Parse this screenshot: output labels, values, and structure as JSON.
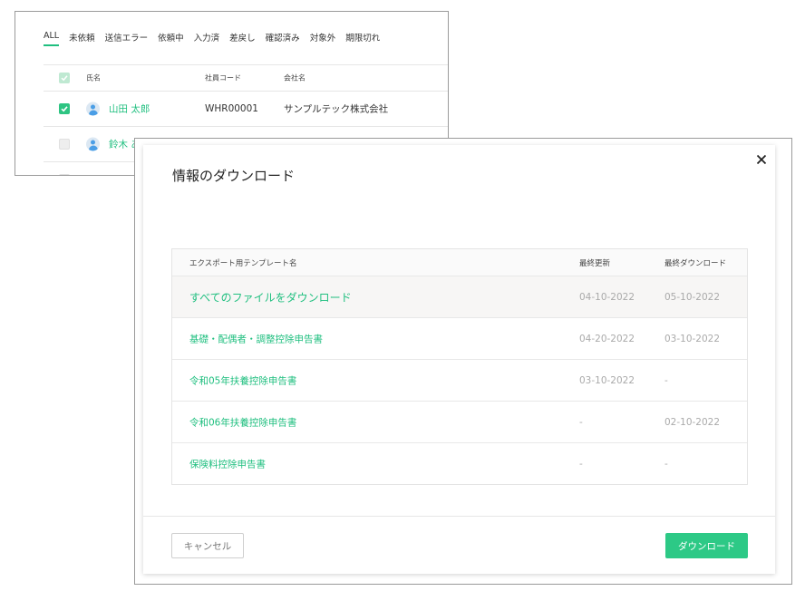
{
  "background_list": {
    "tabs": [
      {
        "label": "ALL",
        "active": true
      },
      {
        "label": "未依頼"
      },
      {
        "label": "送信エラー"
      },
      {
        "label": "依頼中"
      },
      {
        "label": "入力済"
      },
      {
        "label": "差戻し"
      },
      {
        "label": "確認済み"
      },
      {
        "label": "対象外"
      },
      {
        "label": "期限切れ"
      }
    ],
    "columns": {
      "name": "氏名",
      "code": "社員コード",
      "company": "会社名"
    },
    "rows": [
      {
        "name": "山田 太郎",
        "code": "WHR00001",
        "company": "サンプルテック株式会社",
        "checked": true
      },
      {
        "name": "鈴木 あ",
        "code": "",
        "company": "",
        "checked": false
      }
    ]
  },
  "modal": {
    "title": "情報のダウンロード",
    "table": {
      "headers": {
        "template_name": "エクスポート用テンプレート名",
        "last_updated": "最終更新",
        "last_download": "最終ダウンロード"
      },
      "rows": [
        {
          "name": "すべてのファイルをダウンロード",
          "updated": "04-10-2022",
          "downloaded": "05-10-2022"
        },
        {
          "name": "基礎・配偶者・調整控除申告書",
          "updated": "04-20-2022",
          "downloaded": "03-10-2022"
        },
        {
          "name": "令和05年扶養控除申告書",
          "updated": "03-10-2022",
          "downloaded": "-"
        },
        {
          "name": "令和06年扶養控除申告書",
          "updated": "-",
          "downloaded": "02-10-2022"
        },
        {
          "name": "保険料控除申告書",
          "updated": "-",
          "downloaded": "-"
        }
      ]
    },
    "buttons": {
      "cancel": "キャンセル",
      "download": "ダウンロード"
    }
  },
  "icons": {
    "close": "close-icon",
    "checkbox": "checkbox-checked-icon",
    "avatar": "user-avatar-icon"
  },
  "colors": {
    "accent": "#2dc986",
    "link": "#1fbf7f",
    "muted": "#aaaaaa",
    "border": "#9a9a9a"
  }
}
